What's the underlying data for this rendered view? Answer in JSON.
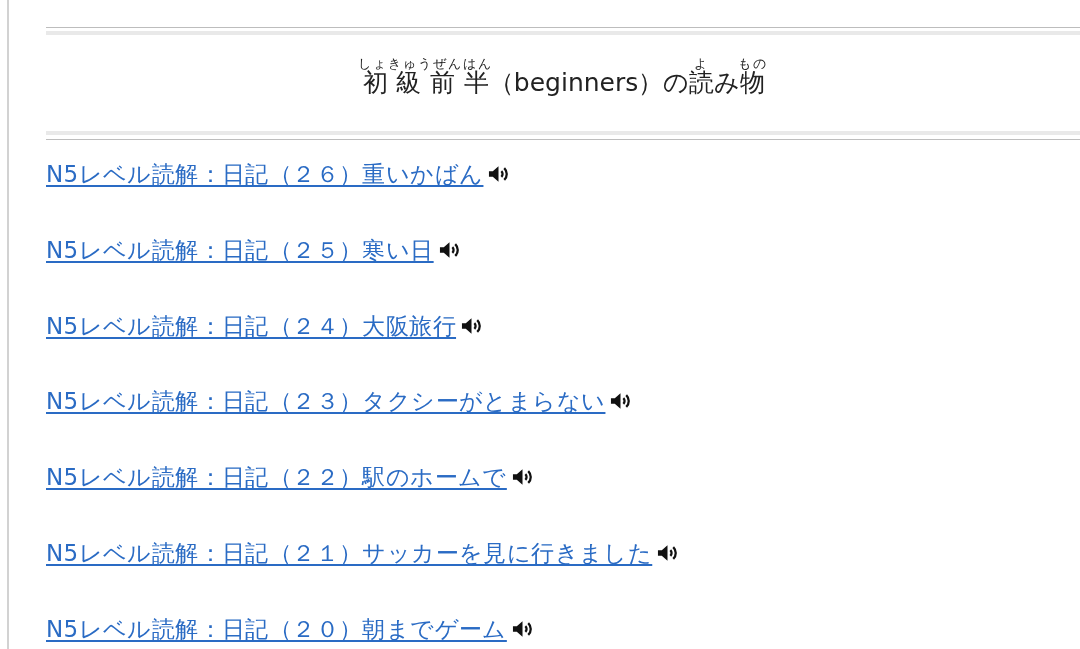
{
  "header": {
    "title": [
      {
        "text": "初級前半",
        "ruby": "しょきゅうぜんはん"
      },
      {
        "text": "（beginners）の"
      },
      {
        "text": "読",
        "ruby": "よ"
      },
      {
        "text": "み"
      },
      {
        "text": "物",
        "ruby": "もの"
      }
    ]
  },
  "articles": [
    {
      "title": "N5レベル読解：日記（２６）重いかばん",
      "audio": true
    },
    {
      "title": "N5レベル読解：日記（２５）寒い日",
      "audio": true
    },
    {
      "title": "N5レベル読解：日記（２４）大阪旅行",
      "audio": true
    },
    {
      "title": "N5レベル読解：日記（２３）タクシーがとまらない",
      "audio": true
    },
    {
      "title": "N5レベル読解：日記（２２）駅のホームで",
      "audio": true
    },
    {
      "title": "N5レベル読解：日記（２１）サッカーを見に行きました",
      "audio": true
    },
    {
      "title": "N5レベル読解：日記（２０）朝までゲーム",
      "audio": true
    }
  ]
}
